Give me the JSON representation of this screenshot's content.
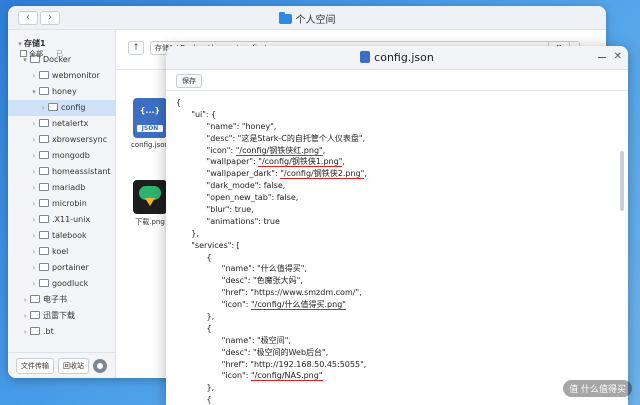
{
  "file_manager": {
    "title": "个人空间",
    "nav": {
      "back": "‹",
      "forward": "›"
    },
    "path": "存储1 / Docker / honey / config /",
    "view_label": "Ⅲ",
    "select_all": "全部",
    "more_tools": "已",
    "sidebar": {
      "root": "存储1",
      "items": [
        {
          "label": "Docker",
          "depth": 1,
          "expanded": true
        },
        {
          "label": "webmonitor",
          "depth": 2
        },
        {
          "label": "honey",
          "depth": 2,
          "expanded": true
        },
        {
          "label": "config",
          "depth": 3,
          "selected": true
        },
        {
          "label": "netalertx",
          "depth": 2
        },
        {
          "label": "xbrowsersync",
          "depth": 2
        },
        {
          "label": "mongodb",
          "depth": 2
        },
        {
          "label": "homeassistant",
          "depth": 2
        },
        {
          "label": "mariadb",
          "depth": 2
        },
        {
          "label": "microbin",
          "depth": 2
        },
        {
          "label": ".X11-unix",
          "depth": 2
        },
        {
          "label": "talebook",
          "depth": 2
        },
        {
          "label": "koel",
          "depth": 2
        },
        {
          "label": "portainer",
          "depth": 2
        },
        {
          "label": "goodluck",
          "depth": 2
        },
        {
          "label": "电子书",
          "depth": 1
        },
        {
          "label": "迅雷下载",
          "depth": 1
        },
        {
          "label": ".bt",
          "depth": 1
        }
      ]
    },
    "footer": {
      "transfer": "文件传输",
      "trash": "回收站"
    },
    "files": [
      {
        "name": "config.json",
        "type": "json",
        "badge": "JSON",
        "brace": "{...}"
      },
      {
        "name": "下载.png",
        "type": "png"
      }
    ]
  },
  "editor": {
    "title": "config.json",
    "save_label": "保存",
    "lines": [
      {
        "t": "{",
        "i": 0
      },
      {
        "t": "\"ui\": {",
        "i": 1
      },
      {
        "t": "\"name\": \"honey\",",
        "i": 2
      },
      {
        "t": "\"desc\": \"这是Stark-C的自托管个人仪表盘\",",
        "i": 2
      },
      {
        "pre": "\"icon\": ",
        "u": "\"/config/钢铁侠红.png\"",
        "post": ",",
        "i": 2
      },
      {
        "pre": "\"wallpaper\": ",
        "u": "\"/config/钢铁侠1.png\"",
        "post": ",",
        "i": 2
      },
      {
        "pre": "\"wallpaper_dark\": ",
        "u": "\"/config/钢铁侠2.png\"",
        "post": ",",
        "i": 2
      },
      {
        "t": "\"dark_mode\": false,",
        "i": 2
      },
      {
        "t": "\"open_new_tab\": false,",
        "i": 2
      },
      {
        "t": "\"blur\": true,",
        "i": 2
      },
      {
        "t": "\"animations\": true",
        "i": 2
      },
      {
        "t": "},",
        "i": 1
      },
      {
        "t": "\"services\": [",
        "i": 1
      },
      {
        "t": "{",
        "i": 2
      },
      {
        "t": "\"name\": \"什么值得买\",",
        "i": 3
      },
      {
        "t": "\"desc\": \"色魔张大妈\",",
        "i": 3
      },
      {
        "t": "\"href\": \"https://www.smzdm.com/\",",
        "i": 3
      },
      {
        "pre": "\"icon\": ",
        "u": "\"/config/什么值得买.png\"",
        "post": "",
        "i": 3
      },
      {
        "t": "},",
        "i": 2
      },
      {
        "t": "{",
        "i": 2
      },
      {
        "t": "\"name\": \"极空间\",",
        "i": 3
      },
      {
        "t": "\"desc\": \"极空间的Web后台\",",
        "i": 3
      },
      {
        "t": "\"href\": \"http://192.168.50.45:5055\",",
        "i": 3
      },
      {
        "pre": "\"icon\": ",
        "u": "\"/config/NAS.png\"",
        "post": "",
        "i": 3
      },
      {
        "t": "},",
        "i": 2
      },
      {
        "t": "{",
        "i": 2
      }
    ]
  },
  "watermark": "值 什么值得买"
}
